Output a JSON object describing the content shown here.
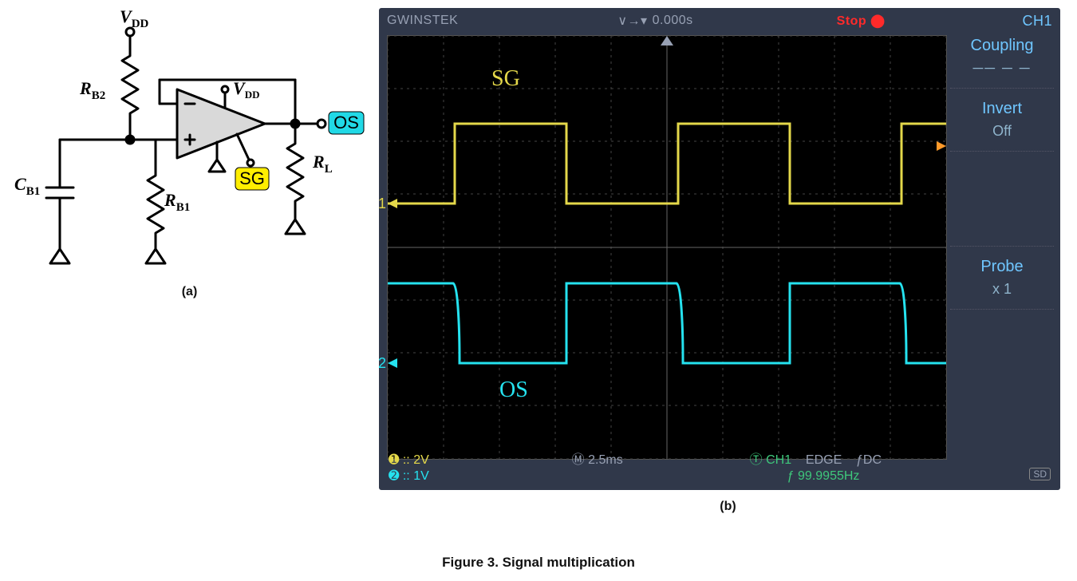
{
  "figure": {
    "caption": "Figure 3. Signal multiplication",
    "sub_a": "(a)",
    "sub_b": "(b)"
  },
  "circuit": {
    "Vdd_top": "V",
    "Vdd_top_sub": "DD",
    "Vdd_amp": "V",
    "Vdd_amp_sub": "DD",
    "Rb2": "R",
    "Rb2_sub": "B2",
    "Rb1": "R",
    "Rb1_sub": "B1",
    "Cb1": "C",
    "Cb1_sub": "B1",
    "RL": "R",
    "RL_sub": "L",
    "sg_tag": "SG",
    "os_tag": "OS"
  },
  "scope": {
    "brand": "GWINSTEK",
    "arrow_sym": "∨→▾",
    "time_value": "0.000s",
    "stop": "Stop ⬤",
    "channel_title": "CH1",
    "side": {
      "coupling_label": "Coupling",
      "coupling_opts_glyph": "── ─ ─",
      "invert_label": "Invert",
      "invert_value": "Off",
      "probe_label": "Probe",
      "probe_value": "x 1"
    },
    "bottom": {
      "ch1_scale_tag": "➊",
      "ch1_scale": ":: 2V",
      "ch2_scale_tag": "➋",
      "ch2_scale": ":: 1V",
      "timebase_tag": "Ⓜ",
      "timebase": "2.5ms",
      "trig_src_tag": "Ⓣ",
      "trig_src": "CH1",
      "trig_mode": "EDGE",
      "trig_coupling": "ƒDC",
      "freq_tag": "ƒ",
      "freq": "99.9955Hz",
      "sd": "SD"
    },
    "trace_labels": {
      "sg": "SG",
      "os": "OS"
    },
    "ch1_marker": "1",
    "ch2_marker": "2"
  },
  "chart_data": {
    "type": "line",
    "timebase_per_div_ms": 2.5,
    "divisions_x": 10,
    "divisions_y": 8,
    "notes": "Oscilloscope screenshot: CH1 (SG, yellow) square wave 0→2V approx, CH2 (OS, cyan) inverted square ~1→0V, period ≈10 ms (~100 Hz).",
    "series": [
      {
        "name": "SG (CH1)",
        "color": "#e4d84a",
        "volts_per_div": 2,
        "zero_line_div_from_top": 3.2,
        "low_level_V": 0,
        "high_level_V": 2,
        "period_ms": 10.0,
        "transitions_ms": [
          1.0,
          6.0,
          11.0,
          16.0,
          21.0
        ]
      },
      {
        "name": "OS (CH2)",
        "color": "#25e2ef",
        "volts_per_div": 1,
        "zero_line_div_from_top": 6.2,
        "low_level_V": 0,
        "high_level_V": 1,
        "period_ms": 10.0,
        "transitions_ms": [
          1.0,
          6.0,
          11.0,
          16.0,
          21.0
        ],
        "phase": "inverted_relative_to_SG"
      }
    ]
  }
}
